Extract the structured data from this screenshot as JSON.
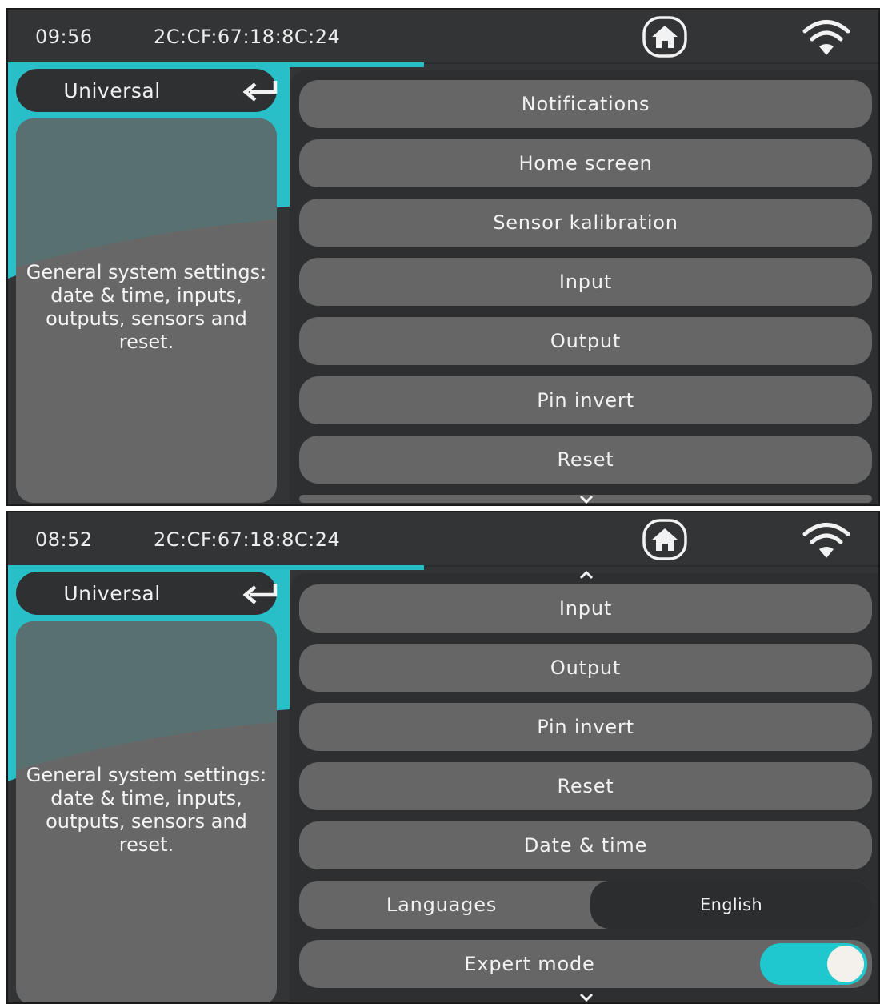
{
  "screens": [
    {
      "status": {
        "time": "09:56",
        "mac": "2C:CF:67:18:8C:24"
      },
      "title": "Universal",
      "description": "General system settings: date & time, inputs, outputs, sensors and reset.",
      "menu": [
        "Notifications",
        "Home screen",
        "Sensor kalibration",
        "Input",
        "Output",
        "Pin invert",
        "Reset"
      ]
    },
    {
      "status": {
        "time": "08:52",
        "mac": "2C:CF:67:18:8C:24"
      },
      "title": "Universal",
      "description": "General system settings: date & time, inputs, outputs, sensors and reset.",
      "menu": [
        "Input",
        "Output",
        "Pin invert",
        "Reset",
        "Date & time"
      ],
      "languages": {
        "label": "Languages",
        "value": "English"
      },
      "expert_mode": {
        "label": "Expert mode",
        "on": true
      }
    }
  ],
  "icons": {
    "home": "home-icon",
    "wifi": "wifi-icon",
    "back": "back-arrow-icon",
    "scroll_down": "chevron-down-icon",
    "scroll_up": "chevron-up-icon"
  },
  "colors": {
    "accent": "#29bfc9",
    "toggle_on": "#1fc8cf",
    "button": "#666666",
    "background": "#333435"
  }
}
